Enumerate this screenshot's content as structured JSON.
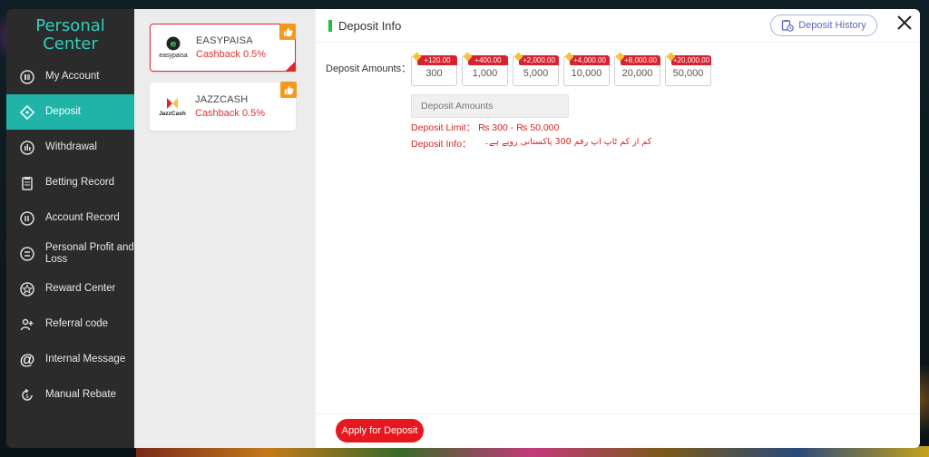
{
  "sidebar": {
    "title_line1": "Personal",
    "title_line2": "Center",
    "items": [
      {
        "label": "My Account",
        "icon": "account-icon"
      },
      {
        "label": "Deposit",
        "icon": "deposit-icon",
        "active": true
      },
      {
        "label": "Withdrawal",
        "icon": "withdrawal-icon"
      },
      {
        "label": "Betting Record",
        "icon": "betting-record-icon"
      },
      {
        "label": "Account Record",
        "icon": "account-record-icon"
      },
      {
        "label": "Personal Profit and Loss",
        "icon": "profit-loss-icon"
      },
      {
        "label": "Reward Center",
        "icon": "reward-icon"
      },
      {
        "label": "Referral code",
        "icon": "referral-icon"
      },
      {
        "label": "Internal Message",
        "icon": "at-icon"
      },
      {
        "label": "Manual Rebate",
        "icon": "rebate-icon"
      }
    ]
  },
  "payments": [
    {
      "name": "EASYPAISA",
      "cashback": "Cashback 0.5%",
      "logo_text": "easypaisa",
      "selected": true
    },
    {
      "name": "JAZZCASH",
      "cashback": "Cashback 0.5%",
      "logo_text": "JazzCash",
      "selected": false
    }
  ],
  "content": {
    "title": "Deposit Info",
    "history_label": "Deposit History",
    "amount_label": "Deposit Amounts：",
    "amounts": [
      {
        "bonus": "+120.00",
        "value": "300"
      },
      {
        "bonus": "+400.00",
        "value": "1,000"
      },
      {
        "bonus": "+2,000.00",
        "value": "5,000"
      },
      {
        "bonus": "+4,000.00",
        "value": "10,000"
      },
      {
        "bonus": "+8,000.00",
        "value": "20,000"
      },
      {
        "bonus": "+20,000.00",
        "value": "50,000"
      }
    ],
    "input_placeholder": "Deposit Amounts",
    "limit_text": "Deposit Limit： ₨ 300  - ₨ 50,000",
    "info_label": "Deposit Info：",
    "info_text": "کم از کم ٹاپ اپ رقم 300 پاکستانی روپے ہے۔",
    "apply_label": "Apply for Deposit"
  },
  "colors": {
    "accent": "#1fb4a7",
    "sidebar_title": "#2fd0c0",
    "danger": "#e5252a",
    "badge": "#f39a1e"
  }
}
